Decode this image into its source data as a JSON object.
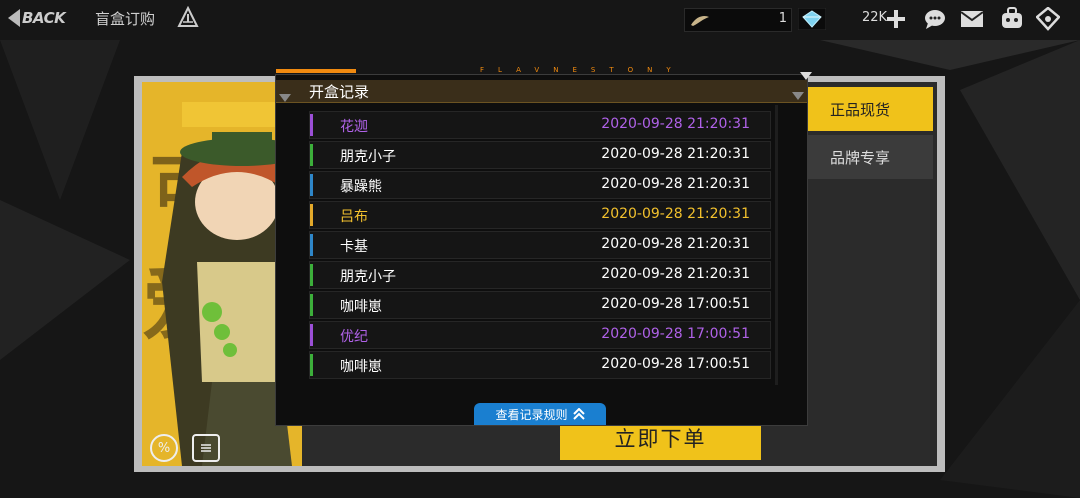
{
  "topbar": {
    "back_label": "BACK",
    "crumb": "盲盒订购",
    "res1_value": "1",
    "gem_count": "22K"
  },
  "card": {
    "btn_genuine": "正品现货",
    "btn_brand": "品牌专享",
    "buy_label": "立即下单"
  },
  "modal": {
    "deco_text": "FLAVNESTONY",
    "title": "开盒记录",
    "rule_label": "查看记录规则",
    "records": [
      {
        "name": "花迦",
        "time": "2020-09-28 21:20:31",
        "color": "#b062e8",
        "bar": "#9b4fd6"
      },
      {
        "name": "朋克小子",
        "time": "2020-09-28 21:20:31",
        "color": "#ffffff",
        "bar": "#3cae3a"
      },
      {
        "name": "暴躁熊",
        "time": "2020-09-28 21:20:31",
        "color": "#ffffff",
        "bar": "#2e86c8"
      },
      {
        "name": "吕布",
        "time": "2020-09-28 21:20:31",
        "color": "#f2c12e",
        "bar": "#e3a92a"
      },
      {
        "name": "卡基",
        "time": "2020-09-28 21:20:31",
        "color": "#ffffff",
        "bar": "#2e86c8"
      },
      {
        "name": "朋克小子",
        "time": "2020-09-28 21:20:31",
        "color": "#ffffff",
        "bar": "#3cae3a"
      },
      {
        "name": "咖啡崽",
        "time": "2020-09-28 17:00:51",
        "color": "#ffffff",
        "bar": "#3cae3a"
      },
      {
        "name": "优纪",
        "time": "2020-09-28 17:00:51",
        "color": "#b062e8",
        "bar": "#9b4fd6"
      },
      {
        "name": "咖啡崽",
        "time": "2020-09-28 17:00:51",
        "color": "#ffffff",
        "bar": "#3cae3a"
      }
    ]
  },
  "icons": {
    "back": "back-arrow-icon",
    "filter": "pyramid-icon",
    "res1": "feather-icon",
    "gem": "diamond-icon",
    "plus": "plus-icon",
    "chat": "chat-icon",
    "mail": "mail-icon",
    "bag": "backpack-icon",
    "home": "home-icon",
    "percent": "percent-icon",
    "doc": "document-icon",
    "chevron": "double-chevron-up-icon"
  }
}
